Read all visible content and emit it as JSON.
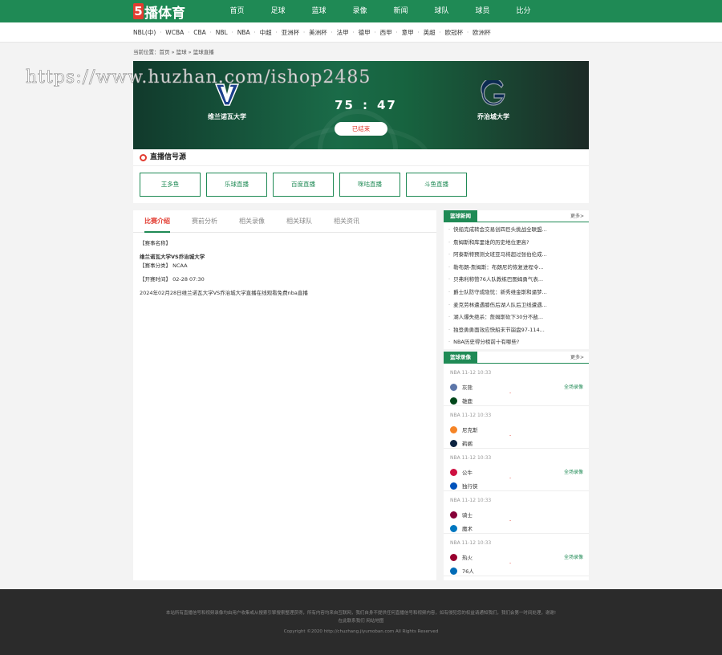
{
  "header": {
    "logo_mark": "5",
    "logo_text": "播体育",
    "nav": [
      "首页",
      "足球",
      "蓝球",
      "录像",
      "新闻",
      "球队",
      "球员",
      "比分"
    ]
  },
  "subnav": [
    "NBL(中)",
    "WCBA",
    "CBA",
    "NBL",
    "NBA",
    "中超",
    "亚洲杯",
    "美洲杯",
    "法甲",
    "德甲",
    "西甲",
    "意甲",
    "英超",
    "欧冠杯",
    "欧洲杯"
  ],
  "breadcrumb": "当前位置：首页 » 篮球 » 篮球直播",
  "watermark": "https://www.huzhan.com/ishop2485",
  "match": {
    "home_team": "维兰诺瓦大学",
    "away_team": "乔治城大学",
    "home_score": "75",
    "away_score": "47",
    "separator": ":",
    "status": "已结束"
  },
  "sources": {
    "title": "直播信号源",
    "buttons": [
      "王多鱼",
      "乐球直播",
      "百度直播",
      "咪咕直播",
      "斗鱼直播"
    ]
  },
  "info": {
    "tabs": [
      "比赛介绍",
      "赛前分析",
      "相关录像",
      "相关球队",
      "相关资讯"
    ],
    "name_label": "【赛事名称】",
    "name_value": "维兰诺瓦大学VS乔治城大学",
    "category_label": "【赛事分类】",
    "category_value": "NCAA",
    "time_label": "【开赛时间】",
    "time_value": "02-28 07:30",
    "description": "2024年02月28日维兰诺瓦大学VS乔治城大学直播在线观看免费nba直播"
  },
  "news": {
    "title": "篮球新闻",
    "more": "更多>",
    "items": [
      "快船完成转会交易创四巨头挑战全联盟...",
      "詹姆斯和库里谁的历史地位更高?",
      "阿泰斯特预测文班亚马将超过张伯伦成...",
      "勒布朗-詹姆斯：布朗尼的恢复进程令...",
      "贝弗利称赞76人队教练巴图姆勇气表...",
      "爵士队防守成隐忧：新秀维金斯和逼梦...",
      "麦克劳林遭遇膝伤后湖人队后卫线遭遇...",
      "湖人爆失绝杀：詹姆斯砍下30分不敌...",
      "独登勇勇面效应快船末节崩盘97-114...",
      "NBA历史得分榜前十有哪些?"
    ]
  },
  "replays": {
    "title": "篮球录像",
    "more": "更多>",
    "replay_label": "全场录像",
    "matches": [
      {
        "time": "NBA 11-12 10:33",
        "home": "灰熊",
        "away": "雄鹿",
        "home_color": "#5d76a9",
        "away_color": "#00471b"
      },
      {
        "time": "NBA 11-12 10:33",
        "home": "尼克斯",
        "away": "鹈鹕",
        "home_color": "#f58426",
        "away_color": "#0c2340"
      },
      {
        "time": "NBA 11-12 10:33",
        "home": "公牛",
        "away": "独行侠",
        "home_color": "#ce1141",
        "away_color": "#0053bc"
      },
      {
        "time": "NBA 11-12 10:33",
        "home": "骑士",
        "away": "魔术",
        "home_color": "#860038",
        "away_color": "#0077c0"
      },
      {
        "time": "NBA 11-12 10:33",
        "home": "热火",
        "away": "76人",
        "home_color": "#98002e",
        "away_color": "#006bb6"
      }
    ]
  },
  "footer": {
    "line1": "本站所有直播信号和视频录像均由用户收集或从搜索引擎搜索整理获得，所有内容均来自互联网，我们自身不提供任何直播信号和视频内容，如有侵犯您的权益请通知我们，我们会第一时间处理，谢谢!",
    "line2": "在此联系我们   网站地图",
    "line3": "Copyright ©2020 http://chuzhang.jiyumoban.com All Rights Reserved"
  }
}
